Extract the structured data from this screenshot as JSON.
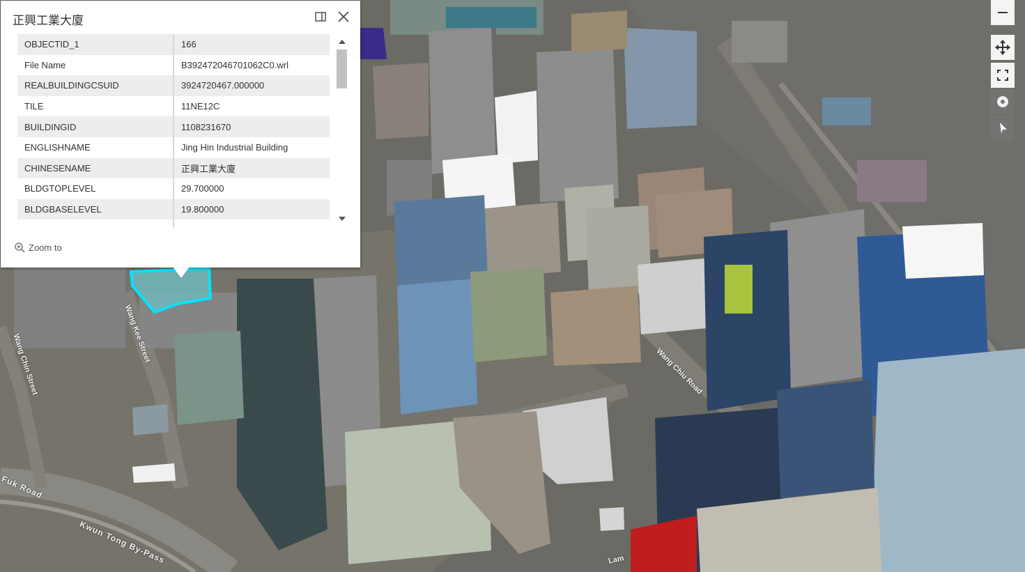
{
  "popup": {
    "title": "正興工業大廈",
    "attributes": [
      {
        "field": "OBJECTID_1",
        "value": "166"
      },
      {
        "field": "File Name",
        "value": "B392472046701062C0.wrl"
      },
      {
        "field": "REALBUILDINGCSUID",
        "value": "3924720467.000000"
      },
      {
        "field": "TILE",
        "value": "11NE12C"
      },
      {
        "field": "BUILDINGID",
        "value": "1108231670"
      },
      {
        "field": "ENGLISHNAME",
        "value": "Jing Hin Industrial Building"
      },
      {
        "field": "CHINESENAME",
        "value": "正興工業大廈"
      },
      {
        "field": "BLDGTOPLEVEL",
        "value": "29.700000"
      },
      {
        "field": "BLDGBASELEVEL",
        "value": "19.800000"
      }
    ],
    "zoom_label": "Zoom to",
    "icons": {
      "dock": "dock-icon",
      "close": "close-icon",
      "zoom": "zoom-in-icon"
    }
  },
  "map_labels": {
    "kwun_tong_bypass": "Kwun Tong By-Pass",
    "fuk_road": "Fuk Road",
    "wang_kee_street": "Wang Kee Street",
    "wang_chiu_road": "Wang Chiu Road",
    "wang_chin_street": "Wang Chin Street",
    "lam": "Lam"
  },
  "toolbar": {
    "items": [
      "zoom-out-icon",
      "pan-icon",
      "fullscreen-icon",
      "record-icon",
      "compass-icon"
    ]
  },
  "colors": {
    "highlight": "#00e5ff",
    "popup_bg": "#ffffff",
    "row_alt": "#ededed"
  }
}
